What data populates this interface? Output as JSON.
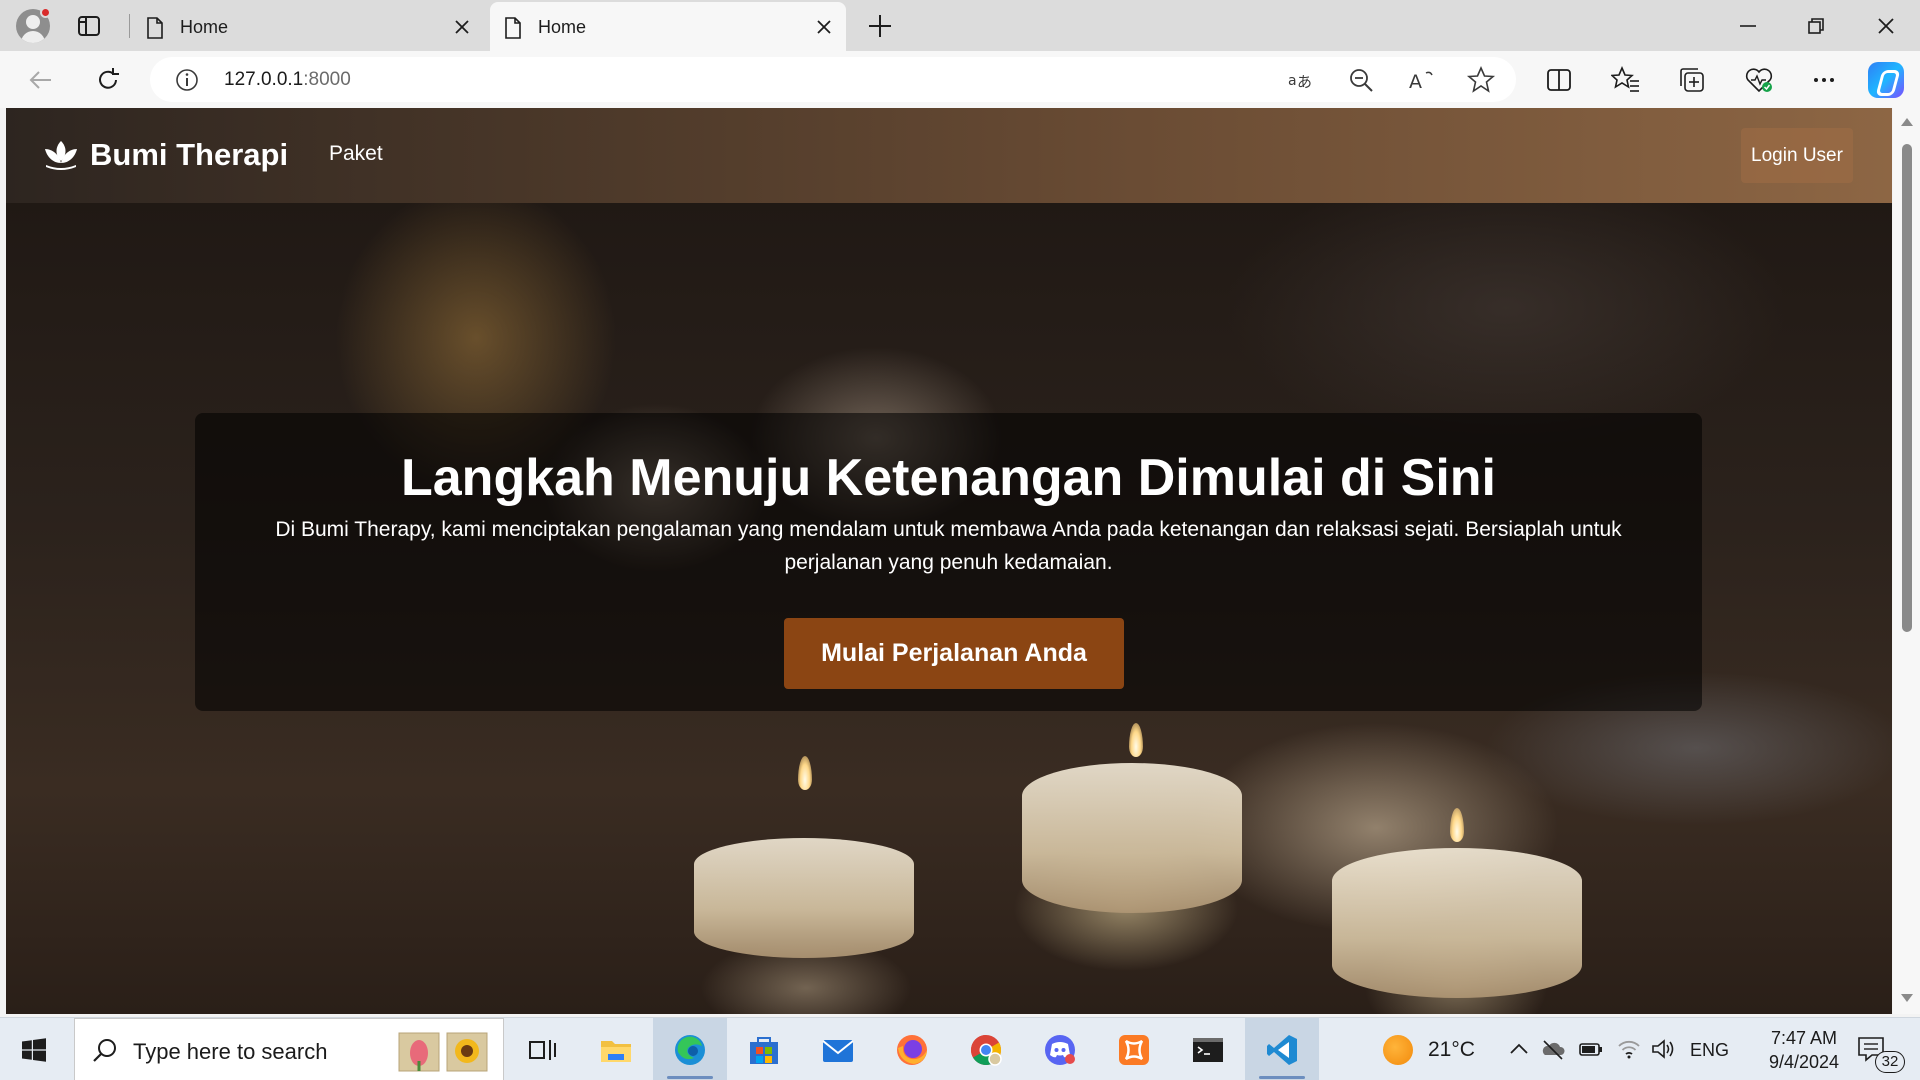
{
  "browser": {
    "tabs": [
      {
        "title": "Home",
        "active": false
      },
      {
        "title": "Home",
        "active": true
      }
    ],
    "address": {
      "host": "127.0.0.1",
      "port": ":8000"
    }
  },
  "site": {
    "brand": "Bumi Therapi",
    "nav": {
      "paket": "Paket",
      "login": "Login User"
    },
    "hero": {
      "title": "Langkah Menuju Ketenangan Dimulai di Sini",
      "description": "Di Bumi Therapy, kami menciptakan pengalaman yang mendalam untuk membawa Anda pada ketenangan dan relaksasi sejati. Bersiaplah untuk perjalanan yang penuh kedamaian.",
      "cta": "Mulai Perjalanan Anda"
    },
    "colors": {
      "accent": "#8b4513"
    }
  },
  "taskbar": {
    "search_placeholder": "Type here to search",
    "apps": [
      "task-view",
      "file-explorer",
      "edge",
      "microsoft-store",
      "mail",
      "firefox",
      "chrome",
      "discord",
      "xampp",
      "terminal",
      "vscode"
    ],
    "weather": {
      "temp": "21°C"
    },
    "lang": "ENG",
    "clock": {
      "time": "7:47 AM",
      "date": "9/4/2024"
    },
    "notifications": "32"
  }
}
